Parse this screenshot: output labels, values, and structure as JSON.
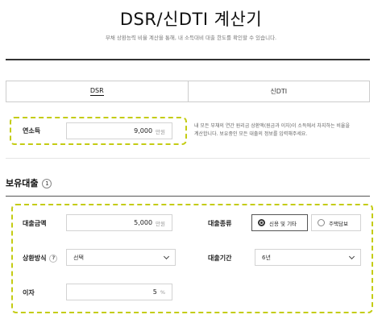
{
  "page": {
    "title": "DSR/신DTI 계산기",
    "subtitle": "부채 상환능력 비율 계산을 통해, 내 소득대비 대출 한도를 확인할 수 있습니다."
  },
  "tabs": [
    {
      "label": "DSR",
      "active": true
    },
    {
      "label": "신DTI",
      "active": false
    }
  ],
  "income": {
    "label": "연소득",
    "value": "9,000",
    "unit": "만원",
    "note": "내 모든 부채의 연간 원리금 상환액(원금과 이자)이 소득에서 차지하는 비율을 계산합니다. 보유중인 모든 대출의 정보를 입력해주세요."
  },
  "loans_section": {
    "title": "보유대출",
    "index": "1"
  },
  "loan_form": {
    "amount_label": "대출금액",
    "amount_value": "5,000",
    "amount_unit": "만원",
    "type_label": "대출종류",
    "type_options": [
      {
        "label": "신용 및 기타",
        "selected": true
      },
      {
        "label": "주택담보",
        "selected": false
      }
    ],
    "repay_label": "상환방식",
    "repay_help": "?",
    "repay_value": "선택",
    "term_label": "대출기간",
    "term_value": "6년",
    "rate_label": "이자",
    "rate_value": "5",
    "rate_unit": "%"
  },
  "colors": {
    "highlight": "#c4cc14",
    "accent": "#111111"
  }
}
